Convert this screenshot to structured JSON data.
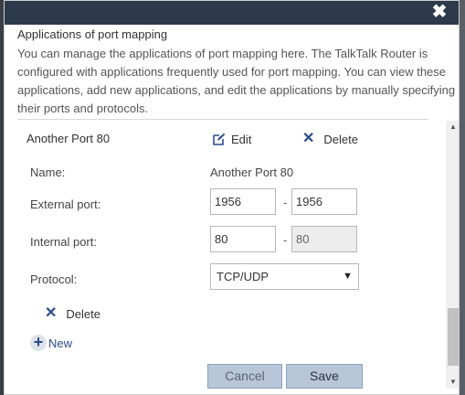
{
  "dialog": {
    "close_symbol": "✖",
    "title": "Applications of port mapping",
    "description": "You can manage the applications of port mapping here. The TalkTalk Router is configured with applications frequently used for port mapping. You can view these applications, add new applications, and edit the applications by manually specifying their ports and protocols."
  },
  "entry": {
    "title": "Another Port 80",
    "edit_label": "Edit",
    "delete_label": "Delete"
  },
  "form": {
    "name_label": "Name:",
    "name_value": "Another Port 80",
    "external_port_label": "External port:",
    "external_port_start": "1956",
    "external_port_end": "1956",
    "internal_port_label": "Internal port:",
    "internal_port_start": "80",
    "internal_port_end": "80",
    "range_separator": "-",
    "protocol_label": "Protocol:",
    "protocol_value": "TCP/UDP",
    "delete_label": "Delete",
    "new_label": "New",
    "cancel_label": "Cancel",
    "save_label": "Save"
  },
  "icons": {
    "close": "close-icon",
    "edit": "edit-icon",
    "delete": "delete-x-icon",
    "add": "plus-circle-icon",
    "dropdown": "triangle-down-icon"
  },
  "colors": {
    "titlebar": "#2d3a4b",
    "accent": "#2c4a8a",
    "button_bg": "#b7c6d8"
  }
}
